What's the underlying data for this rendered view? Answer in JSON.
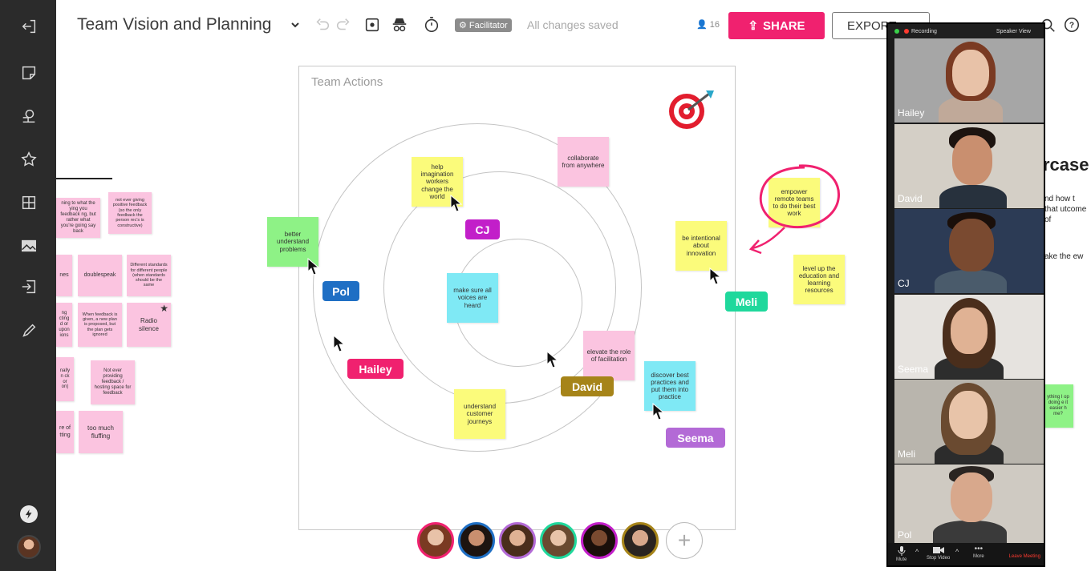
{
  "board": {
    "title": "Team Vision and Planning",
    "facilitator_badge": "Facilitator",
    "save_status": "All changes saved",
    "user_count": "16",
    "share_label": "SHARE",
    "export_label": "EXPORT"
  },
  "frame": {
    "title": "Team Actions"
  },
  "stickies": [
    {
      "text": "help imagination workers change the world",
      "color": "y"
    },
    {
      "text": "collaborate from anywhere",
      "color": "p"
    },
    {
      "text": "better understand problems",
      "color": "g"
    },
    {
      "text": "make sure all voices are heard",
      "color": "c"
    },
    {
      "text": "elevate the role of facilitation",
      "color": "p"
    },
    {
      "text": "discover best practices and put them into practice",
      "color": "c"
    },
    {
      "text": "understand customer journeys",
      "color": "y"
    },
    {
      "text": "be intentional about innovation",
      "color": "y"
    },
    {
      "text": "empower remote teams to do their best work",
      "color": "y"
    },
    {
      "text": "level up the education and learning resources",
      "color": "y"
    }
  ],
  "left_stickies": [
    {
      "text": "ning to what the ying you feedback ng, but rather what you're going say back",
      "color": "p"
    },
    {
      "text": "not ever giving positive feedback (so the only feedback the person rec's is constructive)",
      "color": "p"
    },
    {
      "text": "nes",
      "color": "p"
    },
    {
      "text": "doublespeak",
      "color": "p"
    },
    {
      "text": "Different standards for different people (when standards should be the same",
      "color": "p"
    },
    {
      "text": "ng cting d or upon ions",
      "color": "p"
    },
    {
      "text": "When feedback is given, a new plan is proposed, but the plan gets ignored",
      "color": "p"
    },
    {
      "text": "Radio silence",
      "color": "p"
    },
    {
      "text": "nally n ck or on)",
      "color": "p"
    },
    {
      "text": "Not ever providing feedback / hosting space for feedback",
      "color": "p"
    },
    {
      "text": "re of tting",
      "color": "p"
    },
    {
      "text": "too much fluffing",
      "color": "p"
    }
  ],
  "cursor_tags": [
    {
      "name": "CJ",
      "color": "#c21fc9"
    },
    {
      "name": "Pol",
      "color": "#1f6fc4"
    },
    {
      "name": "Hailey",
      "color": "#f0216f"
    },
    {
      "name": "David",
      "color": "#a68419"
    },
    {
      "name": "Seema",
      "color": "#b36ad6"
    },
    {
      "name": "Meli",
      "color": "#1fd89c"
    }
  ],
  "participants": [
    {
      "name": "Hailey",
      "bg": "#a6a6a6",
      "skin": "#e8c2a8",
      "hair": "#7a3a22",
      "shirt": "#c0a999"
    },
    {
      "name": "David",
      "bg": "#d4cfc6",
      "skin": "#c98f6f",
      "hair": "#1d1410",
      "shirt": "#27313d"
    },
    {
      "name": "CJ",
      "bg": "#2c3b55",
      "skin": "#7a4a30",
      "hair": "#1a0f0a",
      "shirt": "#4a5b6b"
    },
    {
      "name": "Seema",
      "bg": "#e6e3df",
      "skin": "#e0b294",
      "hair": "#4a2e1c",
      "shirt": "#2d2d2d"
    },
    {
      "name": "Meli",
      "bg": "#b9b5ad",
      "skin": "#e8c4a9",
      "hair": "#6a4a30",
      "shirt": "#2c2c2c"
    },
    {
      "name": "Pol",
      "bg": "#cfcac2",
      "skin": "#d8a88c",
      "hair": "#2a2421",
      "shirt": "#3a3a3a"
    }
  ],
  "video_panel": {
    "recording_label": "Recording",
    "view_label": "Speaker View",
    "mute_label": "Mute",
    "stop_video_label": "Stop Video",
    "more_label": "More",
    "leave_label": "Leave Meeting"
  },
  "right_partial": {
    "heading": "rcase",
    "text1": "nd how t that utcome of",
    "text2": "ake the ew",
    "sticky": "ything I op doing e it easier h me?"
  }
}
